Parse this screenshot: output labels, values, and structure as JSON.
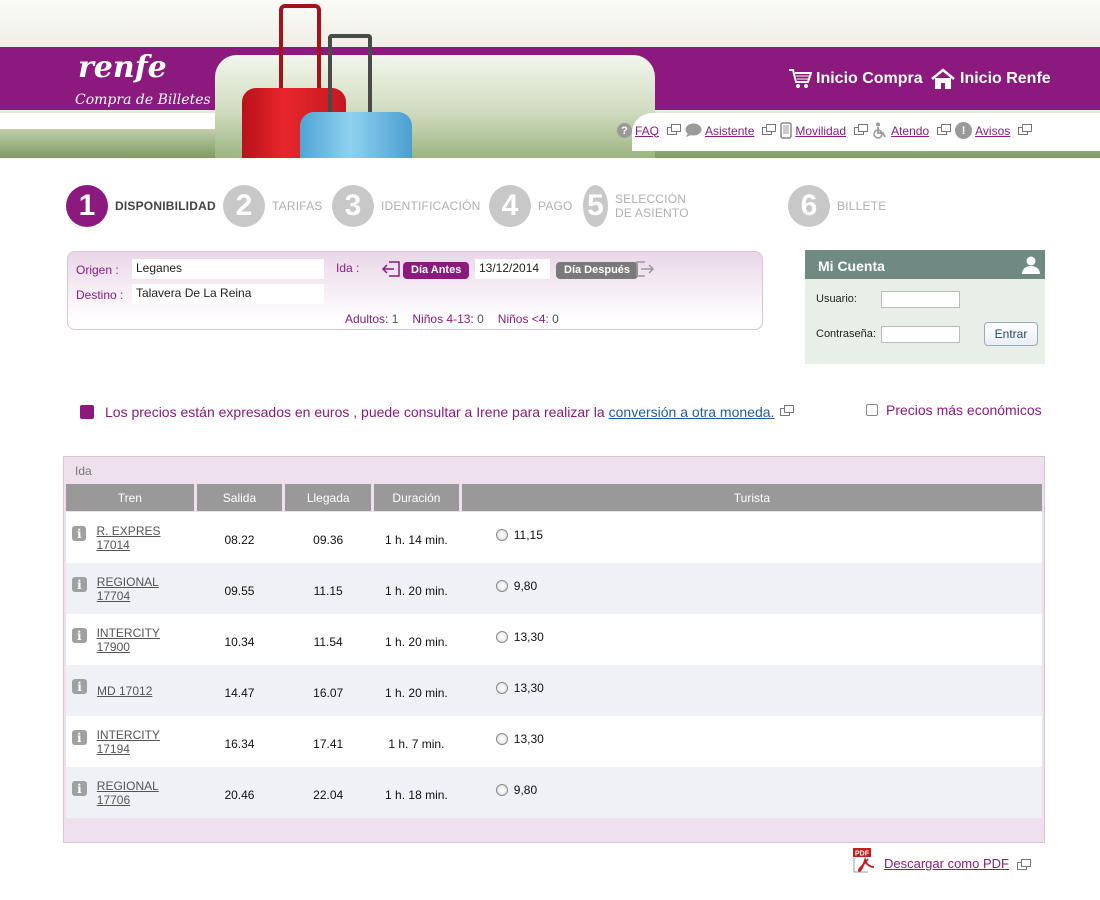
{
  "header": {
    "logo": "renfe",
    "subtitle": "Compra de Billetes",
    "nav": [
      {
        "label": "Inicio Compra",
        "icon": "cart-icon"
      },
      {
        "label": "Inicio Renfe",
        "icon": "home-icon"
      }
    ],
    "links": [
      {
        "label": "FAQ",
        "icon": "question-icon"
      },
      {
        "label": "Asistente",
        "icon": "chat-icon"
      },
      {
        "label": "Movilidad",
        "icon": "mobile-icon"
      },
      {
        "label": "Atendo",
        "icon": "accessibility-icon"
      },
      {
        "label": "Avisos",
        "icon": "alert-icon"
      }
    ]
  },
  "steps": [
    {
      "num": "1",
      "label": "DISPONIBILIDAD",
      "active": true
    },
    {
      "num": "2",
      "label": "TARIFAS",
      "active": false
    },
    {
      "num": "3",
      "label": "IDENTIFICACIÓN",
      "active": false
    },
    {
      "num": "4",
      "label": "PAGO",
      "active": false
    },
    {
      "num": "5",
      "label": "SELECCIÓN DE ASIENTO",
      "active": false
    },
    {
      "num": "6",
      "label": "BILLETE",
      "active": false
    }
  ],
  "search": {
    "origin_label": "Origen :",
    "origin": "Leganes",
    "destination_label": "Destino :",
    "destination": "Talavera De La Reina",
    "ida_label": "Ida :",
    "prev_day": "Día Antes",
    "date": "13/12/2014",
    "next_day": "Día Después",
    "adults_label": "Adultos:",
    "adults": "1",
    "children_label": "Niños 4-13:",
    "children": "0",
    "infants_label": "Niños <4:",
    "infants": "0"
  },
  "account": {
    "title": "Mi Cuenta",
    "user_label": "Usuario:",
    "user_value": "",
    "password_label": "Contraseña:",
    "password_value": "",
    "submit": "Entrar"
  },
  "notice": {
    "text": "Los precios están expresados en euros , puede consultar a Irene para realizar la",
    "link": "conversión a otra moneda.",
    "cheapest_label": "Precios más económicos",
    "cheapest_checked": false
  },
  "results": {
    "title": "Ida",
    "columns": [
      "Tren",
      "Salida",
      "Llegada",
      "Duración",
      "Turista"
    ],
    "rows": [
      {
        "train": "R. EXPRES 17014",
        "departure": "08.22",
        "arrival": "09.36",
        "duration": "1 h. 14 min.",
        "price": "11,15"
      },
      {
        "train": "REGIONAL 17704",
        "departure": "09.55",
        "arrival": "11.15",
        "duration": "1 h. 20 min.",
        "price": "9,80"
      },
      {
        "train": "INTERCITY 17900",
        "departure": "10.34",
        "arrival": "11.54",
        "duration": "1 h. 20 min.",
        "price": "13,30"
      },
      {
        "train": "MD 17012",
        "departure": "14.47",
        "arrival": "16.07",
        "duration": "1 h. 20 min.",
        "price": "13,30"
      },
      {
        "train": "INTERCITY 17194",
        "departure": "16.34",
        "arrival": "17.41",
        "duration": "1 h. 7 min.",
        "price": "13,30"
      },
      {
        "train": "REGIONAL 17706",
        "departure": "20.46",
        "arrival": "22.04",
        "duration": "1 h. 18 min.",
        "price": "9,80"
      }
    ]
  },
  "pdf": {
    "label": "Descargar como PDF",
    "icon_text": "PDF"
  },
  "colors": {
    "brand": "#8c1a7e",
    "account_header": "#6f8a82",
    "table_header": "#999999"
  }
}
